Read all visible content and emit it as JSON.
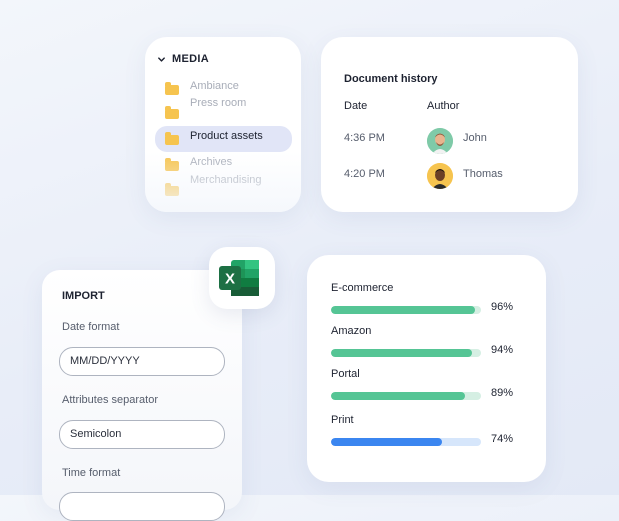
{
  "media": {
    "title": "MEDIA",
    "items": [
      {
        "label": "Ambiance",
        "active": false
      },
      {
        "label": "Press room",
        "active": false
      },
      {
        "label": "Product assets",
        "active": true
      },
      {
        "label": "Archives",
        "active": false
      },
      {
        "label": "Merchandising",
        "active": false
      }
    ]
  },
  "doc_history": {
    "title": "Document history",
    "col_date": "Date",
    "col_author": "Author",
    "rows": [
      {
        "time": "4:36 PM",
        "author": "John",
        "avatar_color": "#7fcaa8"
      },
      {
        "time": "4:20 PM",
        "author": "Thomas",
        "avatar_color": "#f6c44f"
      }
    ]
  },
  "import": {
    "title": "IMPORT",
    "date_format_label": "Date format",
    "date_format_value": "MM/DD/YYYY",
    "separator_label": "Attributes separator",
    "separator_value": "Semicolon",
    "time_format_label": "Time format"
  },
  "excel": {
    "letter": "X",
    "icon": "excel-icon",
    "color": "#1d7044"
  },
  "channels": [
    {
      "name": "E-commerce",
      "percent": 96,
      "label": "96%",
      "fill": "#55c595",
      "track": "#d5efe3"
    },
    {
      "name": "Amazon",
      "percent": 94,
      "label": "94%",
      "fill": "#55c595",
      "track": "#d5efe3"
    },
    {
      "name": "Portal",
      "percent": 89,
      "label": "89%",
      "fill": "#55c595",
      "track": "#d5efe3"
    },
    {
      "name": "Print",
      "percent": 74,
      "label": "74%",
      "fill": "#3b86f0",
      "track": "#d6e6fb"
    }
  ]
}
